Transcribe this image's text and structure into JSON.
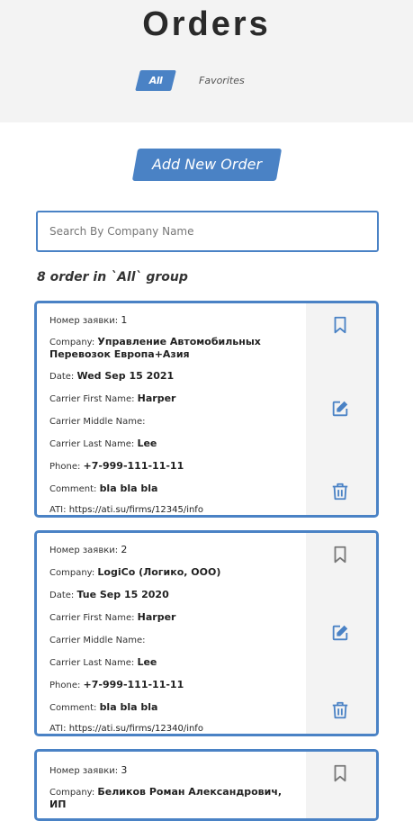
{
  "header": {
    "title": "Orders",
    "tabs": [
      {
        "label": "All",
        "active": true
      },
      {
        "label": "Favorites",
        "active": false
      }
    ]
  },
  "actions": {
    "add_label": "Add New Order"
  },
  "search": {
    "placeholder": "Search By Company Name",
    "value": ""
  },
  "summary": {
    "count_text": "8 order in `All` group"
  },
  "labels": {
    "number": "Номер заявки:",
    "company": "Company:",
    "date": "Date:",
    "carrier_first": "Carrier First Name:",
    "carrier_middle": "Carrier Middle Name:",
    "carrier_last": "Carrier Last Name:",
    "phone": "Phone:",
    "comment": "Comment:",
    "ati": "ATI:"
  },
  "orders": [
    {
      "number": "1",
      "company": "Управление Автомобильных Перевозок Европа+Азия",
      "date": "Wed Sep 15 2021",
      "carrier_first": "Harper",
      "carrier_middle": "",
      "carrier_last": "Lee",
      "phone": "+7-999-111-11-11",
      "comment": "bla bla bla",
      "ati": "https://ati.su/firms/12345/info",
      "favorite": true
    },
    {
      "number": "2",
      "company": "LogiCo (Логико, ООО)",
      "date": "Tue Sep 15 2020",
      "carrier_first": "Harper",
      "carrier_middle": "",
      "carrier_last": "Lee",
      "phone": "+7-999-111-11-11",
      "comment": "bla bla bla",
      "ati": "https://ati.su/firms/12340/info",
      "favorite": false
    },
    {
      "number": "3",
      "company": "Беликов Роман Александрович, ИП",
      "favorite": false
    }
  ],
  "colors": {
    "accent": "#4a82c5",
    "header_bg": "#f3f3f3",
    "side_bg": "#f3f3f3"
  },
  "icons": {
    "favorite": "bookmark-icon",
    "edit": "edit-icon",
    "delete": "trash-icon"
  }
}
